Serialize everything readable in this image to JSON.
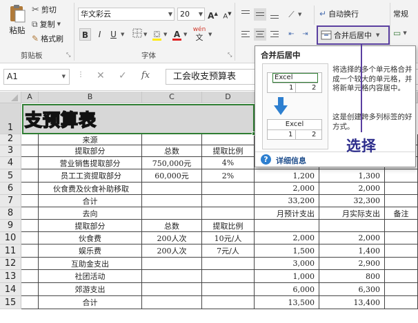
{
  "ribbon": {
    "clipboard": {
      "paste": "粘贴",
      "cut": "剪切",
      "copy": "复制",
      "format_painter": "格式刷",
      "group_label": "剪贴板"
    },
    "font": {
      "name": "华文彩云",
      "size": "20",
      "bold": "B",
      "italic": "I",
      "underline": "U",
      "grow": "A",
      "shrink": "A",
      "group_label": "字体",
      "pinyin": "wén",
      "pinyin2": "文"
    },
    "alignment": {
      "wrap_text": "自动换行",
      "merge_center": "合并后居中"
    },
    "number": {
      "format": "常规"
    }
  },
  "formula_bar": {
    "name_box": "A1",
    "fx": "fx",
    "content": "工会收支预算表"
  },
  "columns": [
    "A",
    "B",
    "C",
    "D"
  ],
  "rows": [
    {
      "n": "1",
      "a": "",
      "b": "",
      "c": "",
      "d": "",
      "e": "",
      "f": "",
      "g": ""
    },
    {
      "n": "2",
      "a": "",
      "b": "来源",
      "c": "",
      "d": "",
      "e": "",
      "f": "",
      "g": ""
    },
    {
      "n": "3",
      "a": "",
      "b": "提取部分",
      "c": "总数",
      "d": "提取比例",
      "e": "",
      "f": "",
      "g": ""
    },
    {
      "n": "4",
      "a": "",
      "b": "营业销售提取部分",
      "c": "750,000元",
      "d": "4%",
      "e": "",
      "f": "",
      "g": ""
    },
    {
      "n": "5",
      "a": "",
      "b": "员工工资提取部分",
      "c": "60,000元",
      "d": "2%",
      "e": "1,200",
      "f": "1,300",
      "g": ""
    },
    {
      "n": "6",
      "a": "",
      "b": "伙食费及伙食补助移取",
      "c": "",
      "d": "",
      "e": "2,000",
      "f": "2,000",
      "g": ""
    },
    {
      "n": "7",
      "a": "",
      "b": "合计",
      "c": "",
      "d": "",
      "e": "33,200",
      "f": "32,300",
      "g": ""
    },
    {
      "n": "8",
      "a": "",
      "b": "去向",
      "c": "",
      "d": "",
      "e": "月预计支出",
      "f": "月实际支出",
      "g": "备注"
    },
    {
      "n": "9",
      "a": "",
      "b": "提取部分",
      "c": "总数",
      "d": "提取比例",
      "e": "",
      "f": "",
      "g": ""
    },
    {
      "n": "10",
      "a": "",
      "b": "伙食费",
      "c": "200人次",
      "d": "10元/人",
      "e": "2,000",
      "f": "2,000",
      "g": ""
    },
    {
      "n": "11",
      "a": "",
      "b": "娱乐费",
      "c": "200人次",
      "d": "7元/人",
      "e": "1,500",
      "f": "1,400",
      "g": ""
    },
    {
      "n": "12",
      "a": "",
      "b": "互助金支出",
      "c": "",
      "d": "",
      "e": "3,000",
      "f": "2,900",
      "g": ""
    },
    {
      "n": "13",
      "a": "",
      "b": "社团活动",
      "c": "",
      "d": "",
      "e": "1,000",
      "f": "800",
      "g": ""
    },
    {
      "n": "14",
      "a": "",
      "b": "郊游支出",
      "c": "",
      "d": "",
      "e": "6,000",
      "f": "6,300",
      "g": ""
    },
    {
      "n": "15",
      "a": "",
      "b": "合计",
      "c": "",
      "d": "",
      "e": "13,500",
      "f": "13,400",
      "g": ""
    }
  ],
  "title_cell": "支预算表",
  "tooltip": {
    "title": "合并后居中",
    "sample_text": "Excel",
    "sample_1": "1",
    "sample_2": "2",
    "desc1": "将选择的多个单元格合并成一个较大的单元格，并将新单元格内容居中。",
    "desc2": "这是创建跨多列标签的好方式。",
    "more_info": "详细信息"
  },
  "annotation": "选择",
  "colors": {
    "highlight": "#5a3fa0",
    "accent_green": "#2e7d32",
    "link": "#1f4e8c"
  }
}
